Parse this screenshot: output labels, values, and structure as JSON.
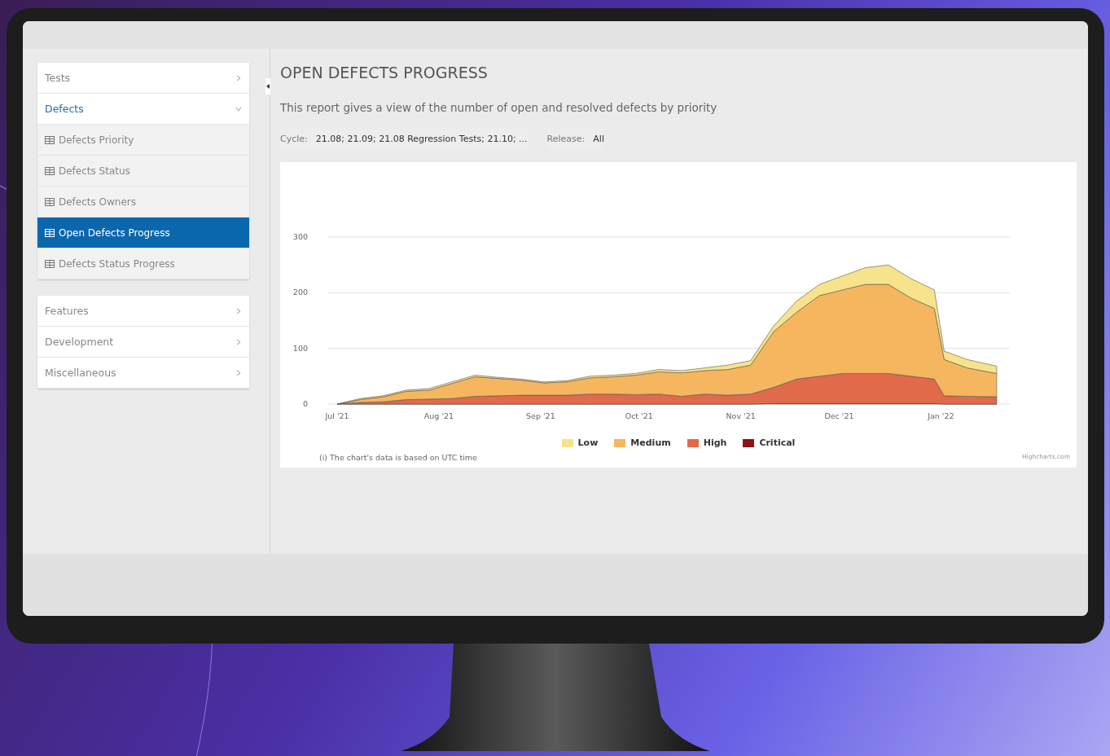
{
  "sidebar": {
    "groups": [
      {
        "items": [
          {
            "label": "Tests",
            "expanded": false
          },
          {
            "label": "Defects",
            "expanded": true,
            "children": [
              {
                "label": "Defects Priority",
                "selected": false
              },
              {
                "label": "Defects Status",
                "selected": false
              },
              {
                "label": "Defects Owners",
                "selected": false
              },
              {
                "label": "Open Defects Progress",
                "selected": true
              },
              {
                "label": "Defects Status Progress",
                "selected": false
              }
            ]
          }
        ]
      },
      {
        "items": [
          {
            "label": "Features",
            "expanded": false
          },
          {
            "label": "Development",
            "expanded": false
          },
          {
            "label": "Miscellaneous",
            "expanded": false
          }
        ]
      }
    ]
  },
  "report": {
    "title": "OPEN DEFECTS PROGRESS",
    "description": "This report gives a view of the number of open and resolved defects by priority",
    "filters": [
      {
        "label": "Cycle:",
        "value": "21.08; 21.09; 21.08 Regression Tests; 21.10; ..."
      },
      {
        "label": "Release:",
        "value": "All"
      }
    ],
    "chart_data": {
      "type": "area",
      "stacked": true,
      "x": [
        "2021-07-01",
        "2021-07-08",
        "2021-07-15",
        "2021-07-22",
        "2021-07-29",
        "2021-08-05",
        "2021-08-12",
        "2021-08-19",
        "2021-08-26",
        "2021-09-02",
        "2021-09-09",
        "2021-09-16",
        "2021-09-23",
        "2021-09-30",
        "2021-10-07",
        "2021-10-14",
        "2021-10-21",
        "2021-10-28",
        "2021-11-04",
        "2021-11-11",
        "2021-11-18",
        "2021-11-25",
        "2021-12-02",
        "2021-12-09",
        "2021-12-16",
        "2021-12-23",
        "2021-12-30",
        "2022-01-02",
        "2022-01-09",
        "2022-01-18"
      ],
      "series": [
        {
          "name": "Critical",
          "color": "#8b1414",
          "values": [
            0,
            0,
            0,
            0,
            0,
            0,
            0,
            0,
            0,
            0,
            0,
            0,
            0,
            0,
            0,
            0,
            0,
            0,
            0,
            1,
            1,
            1,
            1,
            1,
            1,
            1,
            1,
            0,
            0,
            0
          ]
        },
        {
          "name": "High",
          "color": "#e06a4a",
          "values": [
            0,
            3,
            4,
            8,
            9,
            10,
            14,
            15,
            16,
            16,
            16,
            18,
            18,
            17,
            18,
            14,
            18,
            16,
            18,
            29,
            44,
            49,
            54,
            54,
            54,
            49,
            44,
            15,
            14,
            13
          ]
        },
        {
          "name": "Medium",
          "color": "#f5b65f",
          "values": [
            0,
            5,
            9,
            15,
            16,
            27,
            35,
            31,
            27,
            22,
            24,
            29,
            31,
            35,
            40,
            42,
            42,
            46,
            52,
            100,
            120,
            145,
            150,
            160,
            160,
            140,
            127,
            65,
            51,
            42
          ]
        },
        {
          "name": "Low",
          "color": "#f7e38b",
          "values": [
            0,
            2,
            2,
            2,
            3,
            3,
            3,
            2,
            2,
            2,
            2,
            3,
            3,
            3,
            4,
            4,
            5,
            8,
            8,
            10,
            20,
            20,
            25,
            30,
            35,
            35,
            33,
            15,
            15,
            13
          ]
        }
      ],
      "xlim": [
        "2021-06-28",
        "2022-01-22"
      ],
      "ylim": [
        0,
        300
      ],
      "xticks": [
        {
          "value": "2021-07-01",
          "label": "Jul '21"
        },
        {
          "value": "2021-08-01",
          "label": "Aug '21"
        },
        {
          "value": "2021-09-01",
          "label": "Sep '21"
        },
        {
          "value": "2021-10-01",
          "label": "Oct '21"
        },
        {
          "value": "2021-11-01",
          "label": "Nov '21"
        },
        {
          "value": "2021-12-01",
          "label": "Dec '21"
        },
        {
          "value": "2022-01-01",
          "label": "Jan '22"
        }
      ],
      "yticks": [
        0,
        100,
        200,
        300
      ]
    },
    "chart_note": "(i) The chart's data is based on UTC time",
    "chart_credit": "Highcharts.com"
  }
}
